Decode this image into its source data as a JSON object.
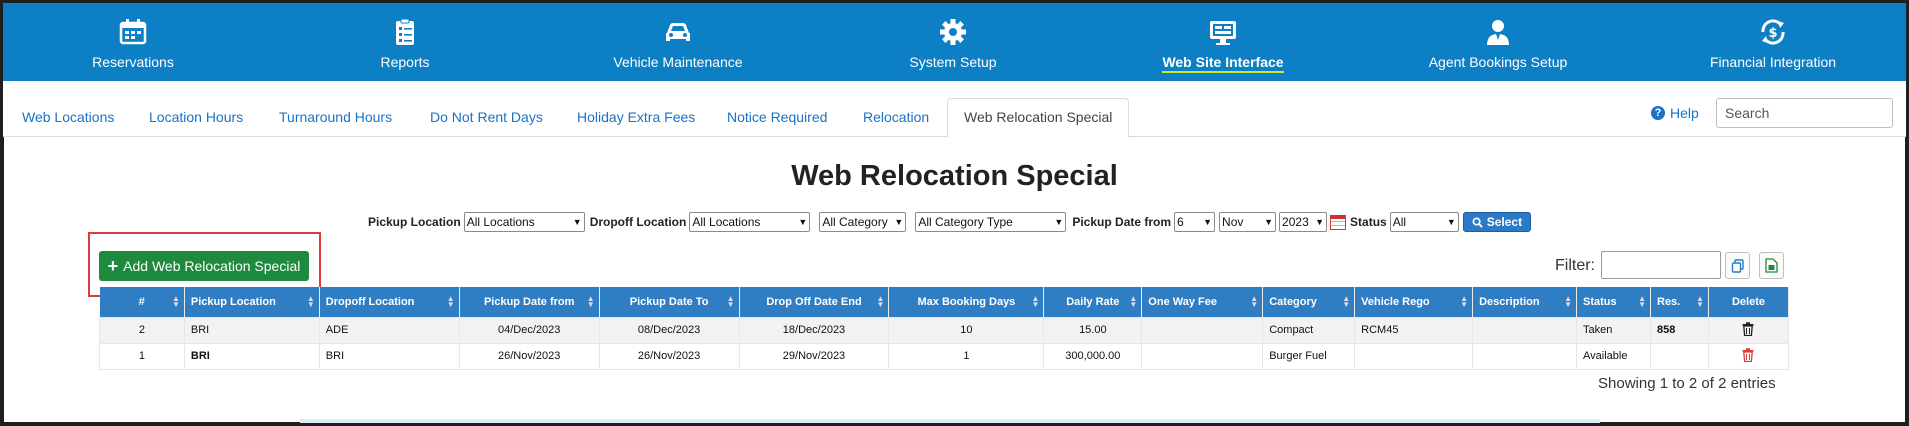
{
  "nav": {
    "items": [
      {
        "label": "Reservations",
        "icon": "calendar-icon"
      },
      {
        "label": "Reports",
        "icon": "clipboard-icon"
      },
      {
        "label": "Vehicle Maintenance",
        "icon": "car-icon"
      },
      {
        "label": "System Setup",
        "icon": "gear-icon"
      },
      {
        "label": "Web Site Interface",
        "icon": "monitor-icon",
        "active": true
      },
      {
        "label": "Agent Bookings Setup",
        "icon": "agent-icon"
      },
      {
        "label": "Financial Integration",
        "icon": "currency-refresh-icon"
      }
    ]
  },
  "subtabs": [
    "Web Locations",
    "Location Hours",
    "Turnaround Hours",
    "Do Not Rent Days",
    "Holiday Extra Fees",
    "Notice Required",
    "Relocation",
    "Web Relocation Special"
  ],
  "help_label": "Help",
  "search_placeholder": "Search",
  "page_title": "Web Relocation Special",
  "filters": {
    "pickup_location_label": "Pickup Location",
    "pickup_location_value": "All Locations",
    "dropoff_location_label": "Dropoff Location",
    "dropoff_location_value": "All Locations",
    "category_value": "All Category",
    "category_type_value": "All Category Type",
    "pickup_date_label": "Pickup Date from",
    "day_value": "6",
    "month_value": "Nov",
    "year_value": "2023",
    "status_label": "Status",
    "status_value": "All",
    "select_label": "Select"
  },
  "add_button_label": "Add Web Relocation Special",
  "filter_label": "Filter:",
  "table": {
    "headers": [
      "#",
      "Pickup Location",
      "Dropoff Location",
      "Pickup Date from",
      "Pickup Date To",
      "Drop Off Date End",
      "Max Booking Days",
      "Daily Rate",
      "One Way Fee",
      "Category",
      "Vehicle Rego",
      "Description",
      "Status",
      "Res.",
      "Delete"
    ],
    "rows": [
      {
        "num": "2",
        "pickup": "BRI",
        "dropoff": "ADE",
        "from": "04/Dec/2023",
        "to": "08/Dec/2023",
        "end": "18/Dec/2023",
        "max_days": "10",
        "rate": "15.00",
        "one_way": "",
        "category": "Compact",
        "rego": "RCM45",
        "description": "",
        "status": "Taken",
        "res": "858"
      },
      {
        "num": "1",
        "pickup": "BRI",
        "dropoff": "BRI",
        "from": "26/Nov/2023",
        "to": "26/Nov/2023",
        "end": "29/Nov/2023",
        "max_days": "1",
        "rate": "300,000.00",
        "one_way": "",
        "category": "Burger Fuel",
        "rego": "",
        "description": "",
        "status": "Available",
        "res": ""
      }
    ]
  },
  "showing_text": "Showing 1 to 2 of 2 entries",
  "colors": {
    "nav_bg": "#0d7fc4",
    "link": "#1a72c9",
    "table_header": "#2f7ec4",
    "add_button": "#1e8a3d",
    "highlight": "#e03a3a"
  }
}
